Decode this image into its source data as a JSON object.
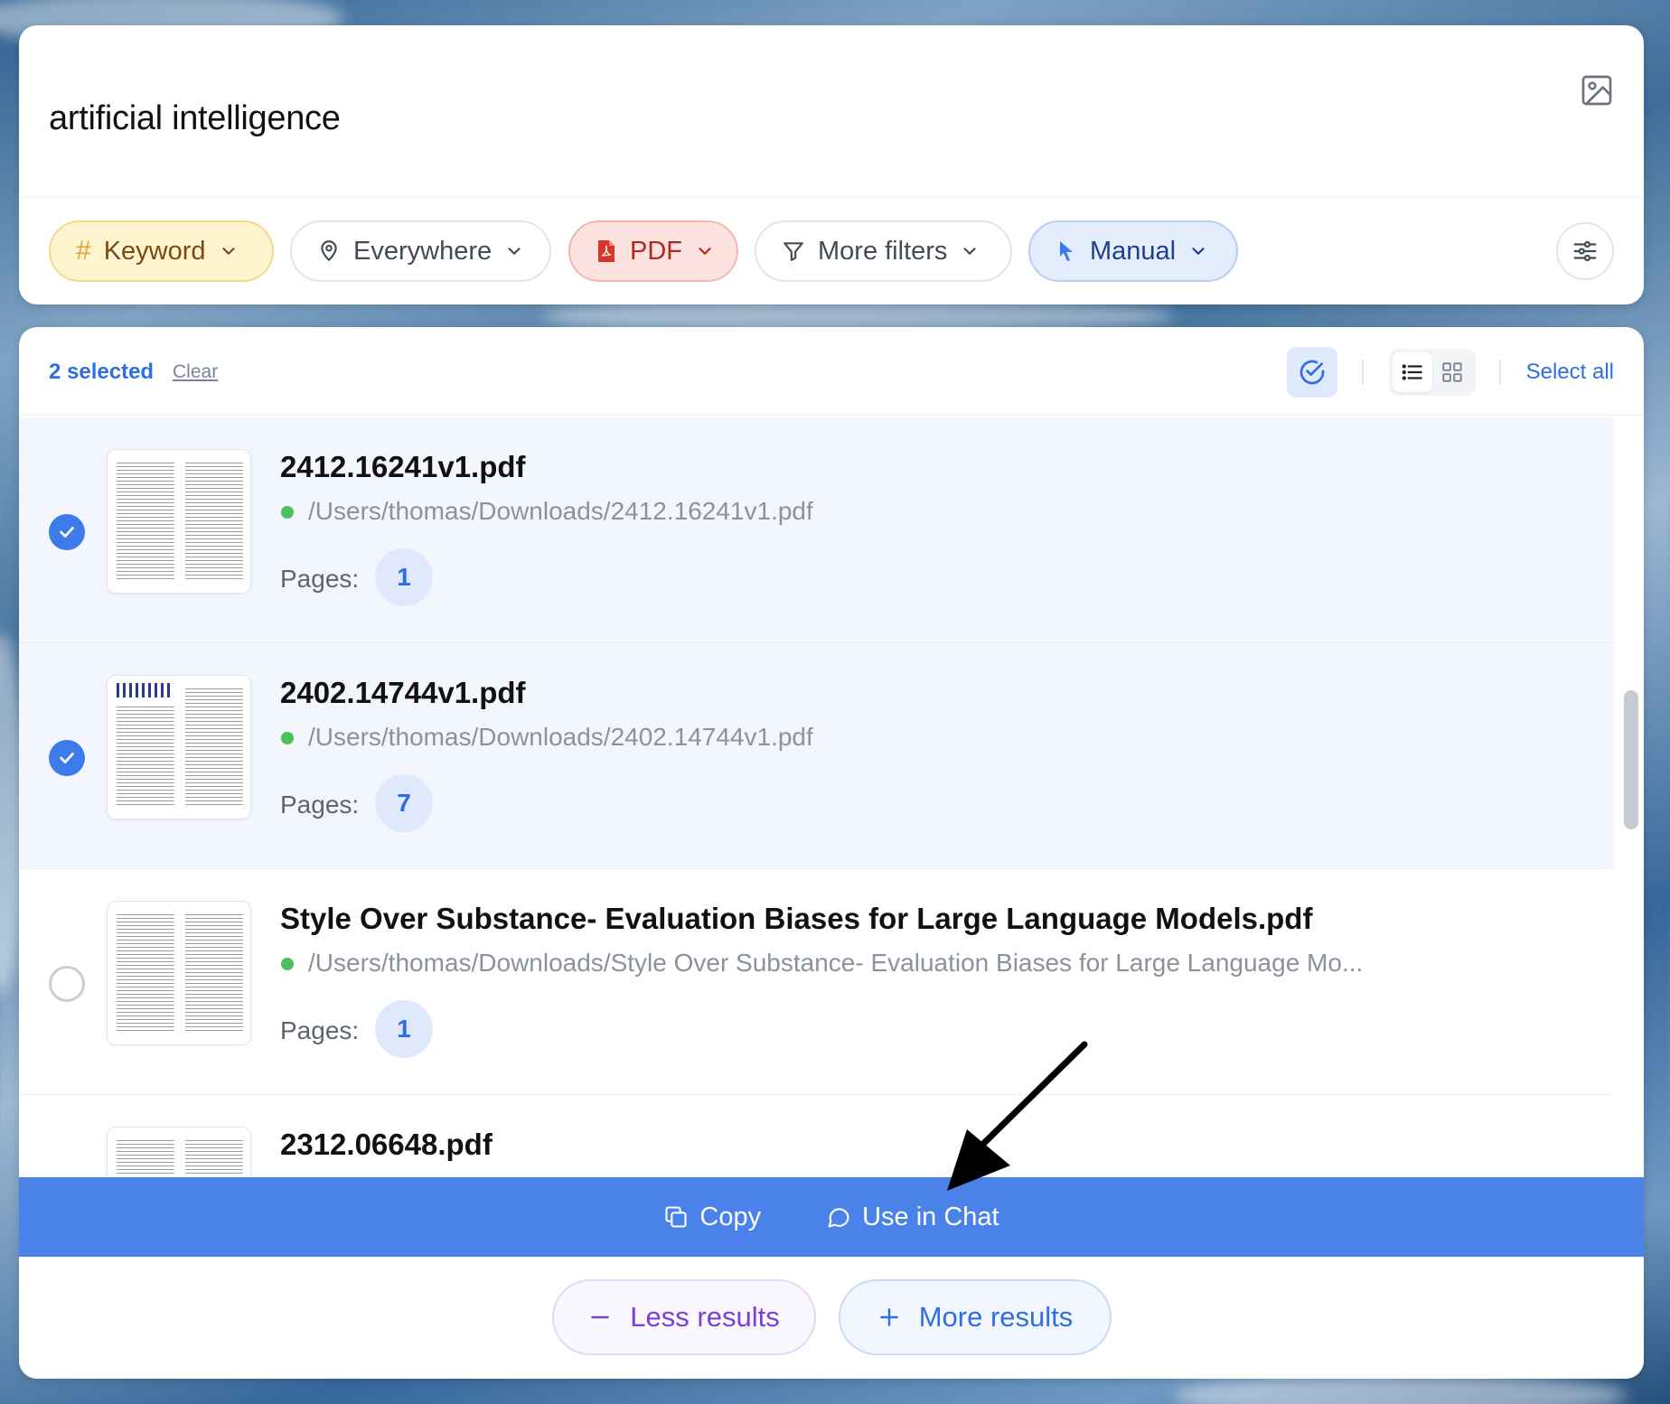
{
  "search": {
    "query": "artificial intelligence",
    "filters": {
      "keyword": "Keyword",
      "location": "Everywhere",
      "file_type": "PDF",
      "more": "More filters",
      "mode": "Manual"
    }
  },
  "toolbar": {
    "selected_text": "2 selected",
    "clear_label": "Clear",
    "select_all_label": "Select all"
  },
  "results": [
    {
      "title": "2412.16241v1.pdf",
      "path": "/Users/thomas/Downloads/2412.16241v1.pdf",
      "pages_label": "Pages:",
      "pages": "1",
      "selected": true
    },
    {
      "title": "2402.14744v1.pdf",
      "path": "/Users/thomas/Downloads/2402.14744v1.pdf",
      "pages_label": "Pages:",
      "pages": "7",
      "selected": true
    },
    {
      "title": "Style Over Substance- Evaluation Biases for Large Language Models.pdf",
      "path": "/Users/thomas/Downloads/Style Over Substance- Evaluation Biases for Large Language Mo...",
      "pages_label": "Pages:",
      "pages": "1",
      "selected": false
    },
    {
      "title": "2312.06648.pdf",
      "selected": false
    }
  ],
  "actions": {
    "copy_label": "Copy",
    "chat_label": "Use in Chat"
  },
  "footer": {
    "less_label": "Less results",
    "more_label": "More results"
  },
  "colors": {
    "accent": "#4a82ea",
    "keyword_pill": "#fdf3cf",
    "pdf_pill": "#fde3e0",
    "manual_pill": "#e4edfc",
    "status_green": "#4fbf5c",
    "less_purple": "#7c3fd6"
  }
}
